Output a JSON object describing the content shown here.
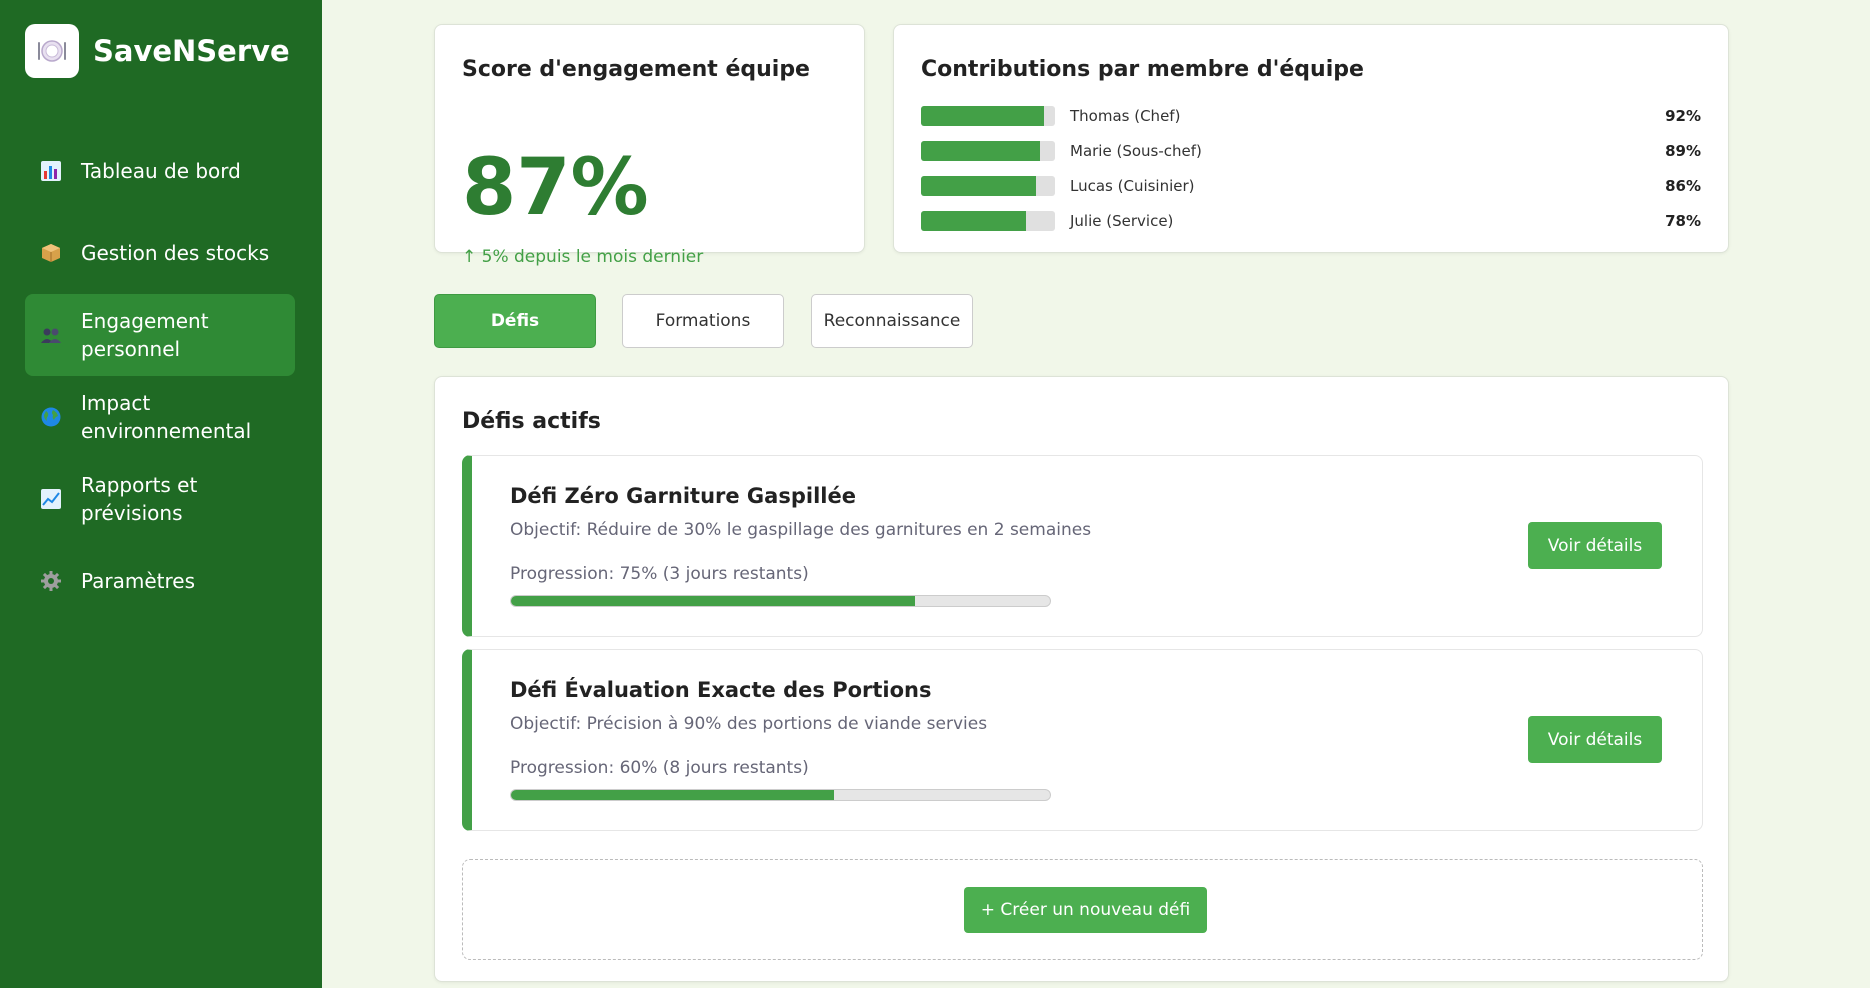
{
  "app": {
    "name": "SaveNServe",
    "logo_icon": "plate-icon"
  },
  "colors": {
    "sidebar": "#1f6a24",
    "accent": "#4caf50",
    "score": "#2e7d32",
    "background": "#f1f7e9"
  },
  "sidebar": {
    "items": [
      {
        "label": "Tableau de bord",
        "icon": "chart-icon",
        "active": false
      },
      {
        "label": "Gestion des stocks",
        "icon": "package-icon",
        "active": false
      },
      {
        "label": "Engagement personnel",
        "icon": "people-icon",
        "active": true
      },
      {
        "label": "Impact environnemental",
        "icon": "globe-icon",
        "active": false
      },
      {
        "label": "Rapports et prévisions",
        "icon": "trend-icon",
        "active": false
      },
      {
        "label": "Paramètres",
        "icon": "gear-icon",
        "active": false
      }
    ]
  },
  "score": {
    "title": "Score d'engagement équipe",
    "value": "87%",
    "trend": "↑ 5% depuis le mois dernier"
  },
  "contributions": {
    "title": "Contributions par membre d'équipe",
    "members": [
      {
        "name": "Thomas (Chef)",
        "pct": "92%",
        "value": 0.92
      },
      {
        "name": "Marie (Sous-chef)",
        "pct": "89%",
        "value": 0.89
      },
      {
        "name": "Lucas (Cuisinier)",
        "pct": "86%",
        "value": 0.86
      },
      {
        "name": "Julie (Service)",
        "pct": "78%",
        "value": 0.78
      }
    ]
  },
  "tabs": [
    {
      "label": "Défis",
      "active": true
    },
    {
      "label": "Formations",
      "active": false
    },
    {
      "label": "Reconnaissance",
      "active": false
    }
  ],
  "defis": {
    "title": "Défis actifs",
    "items": [
      {
        "title": "Défi Zéro Garniture Gaspillée",
        "objective": "Objectif: Réduire de 30% le gaspillage des garnitures en 2 semaines",
        "progress_text": "Progression: 75% (3 jours restants)",
        "progress": 0.75,
        "button": "Voir détails"
      },
      {
        "title": "Défi Évaluation Exacte des Portions",
        "objective": "Objectif: Précision à 90% des portions de viande servies",
        "progress_text": "Progression: 60% (8 jours restants)",
        "progress": 0.6,
        "button": "Voir détails"
      }
    ],
    "new_button": "+ Créer un nouveau défi"
  }
}
